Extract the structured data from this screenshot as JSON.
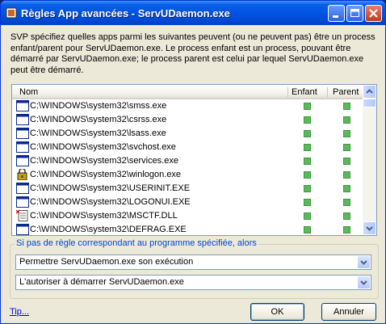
{
  "window": {
    "title": "Règles App avancées - ServUDaemon.exe"
  },
  "description": "SVP spécifiez quelles apps parmi les suivantes  peuvent (ou ne peuvent pas) être un process enfant/parent pour ServUDaemon.exe. Le process enfant est un process, pouvant être démarré par ServUDaemon.exe; le process parent est celui  par lequel ServUDaemon.exe peut être démarré.",
  "list": {
    "columns": {
      "name": "Nom",
      "child": "Enfant",
      "parent": "Parent"
    },
    "rows": [
      {
        "name": "C:\\WINDOWS\\system32\\smss.exe",
        "icon": "window-app-icon",
        "child": true,
        "parent": true
      },
      {
        "name": "C:\\WINDOWS\\system32\\csrss.exe",
        "icon": "window-app-icon",
        "child": true,
        "parent": true
      },
      {
        "name": "C:\\WINDOWS\\system32\\lsass.exe",
        "icon": "window-app-icon",
        "child": true,
        "parent": true
      },
      {
        "name": "C:\\WINDOWS\\system32\\svchost.exe",
        "icon": "window-app-icon",
        "child": true,
        "parent": true
      },
      {
        "name": "C:\\WINDOWS\\system32\\services.exe",
        "icon": "window-app-icon",
        "child": true,
        "parent": true
      },
      {
        "name": "C:\\WINDOWS\\system32\\winlogon.exe",
        "icon": "winlogon-lock-icon",
        "child": true,
        "parent": true
      },
      {
        "name": "C:\\WINDOWS\\system32\\USERINIT.EXE",
        "icon": "window-app-icon",
        "child": true,
        "parent": true
      },
      {
        "name": "C:\\WINDOWS\\system32\\LOGONUI.EXE",
        "icon": "window-app-icon",
        "child": true,
        "parent": true
      },
      {
        "name": "C:\\WINDOWS\\system32\\MSCTF.DLL",
        "icon": "dll-file-icon",
        "child": true,
        "parent": true
      },
      {
        "name": "C:\\WINDOWS\\system32\\DEFRAG.EXE",
        "icon": "window-app-icon",
        "child": true,
        "parent": true
      }
    ]
  },
  "fallback": {
    "label": "Si pas de règle correspondant au programme spécifiée, alors",
    "combo1": "Permettre ServUDaemon.exe son exécution",
    "combo2": "L'autoriser à démarrer ServUDaemon.exe"
  },
  "footer": {
    "tip": "Tip...",
    "ok": "OK",
    "cancel": "Annuler"
  },
  "colors": {
    "titlebar": "#0054e3",
    "check": "#5cb85c",
    "link": "#0000ee"
  }
}
